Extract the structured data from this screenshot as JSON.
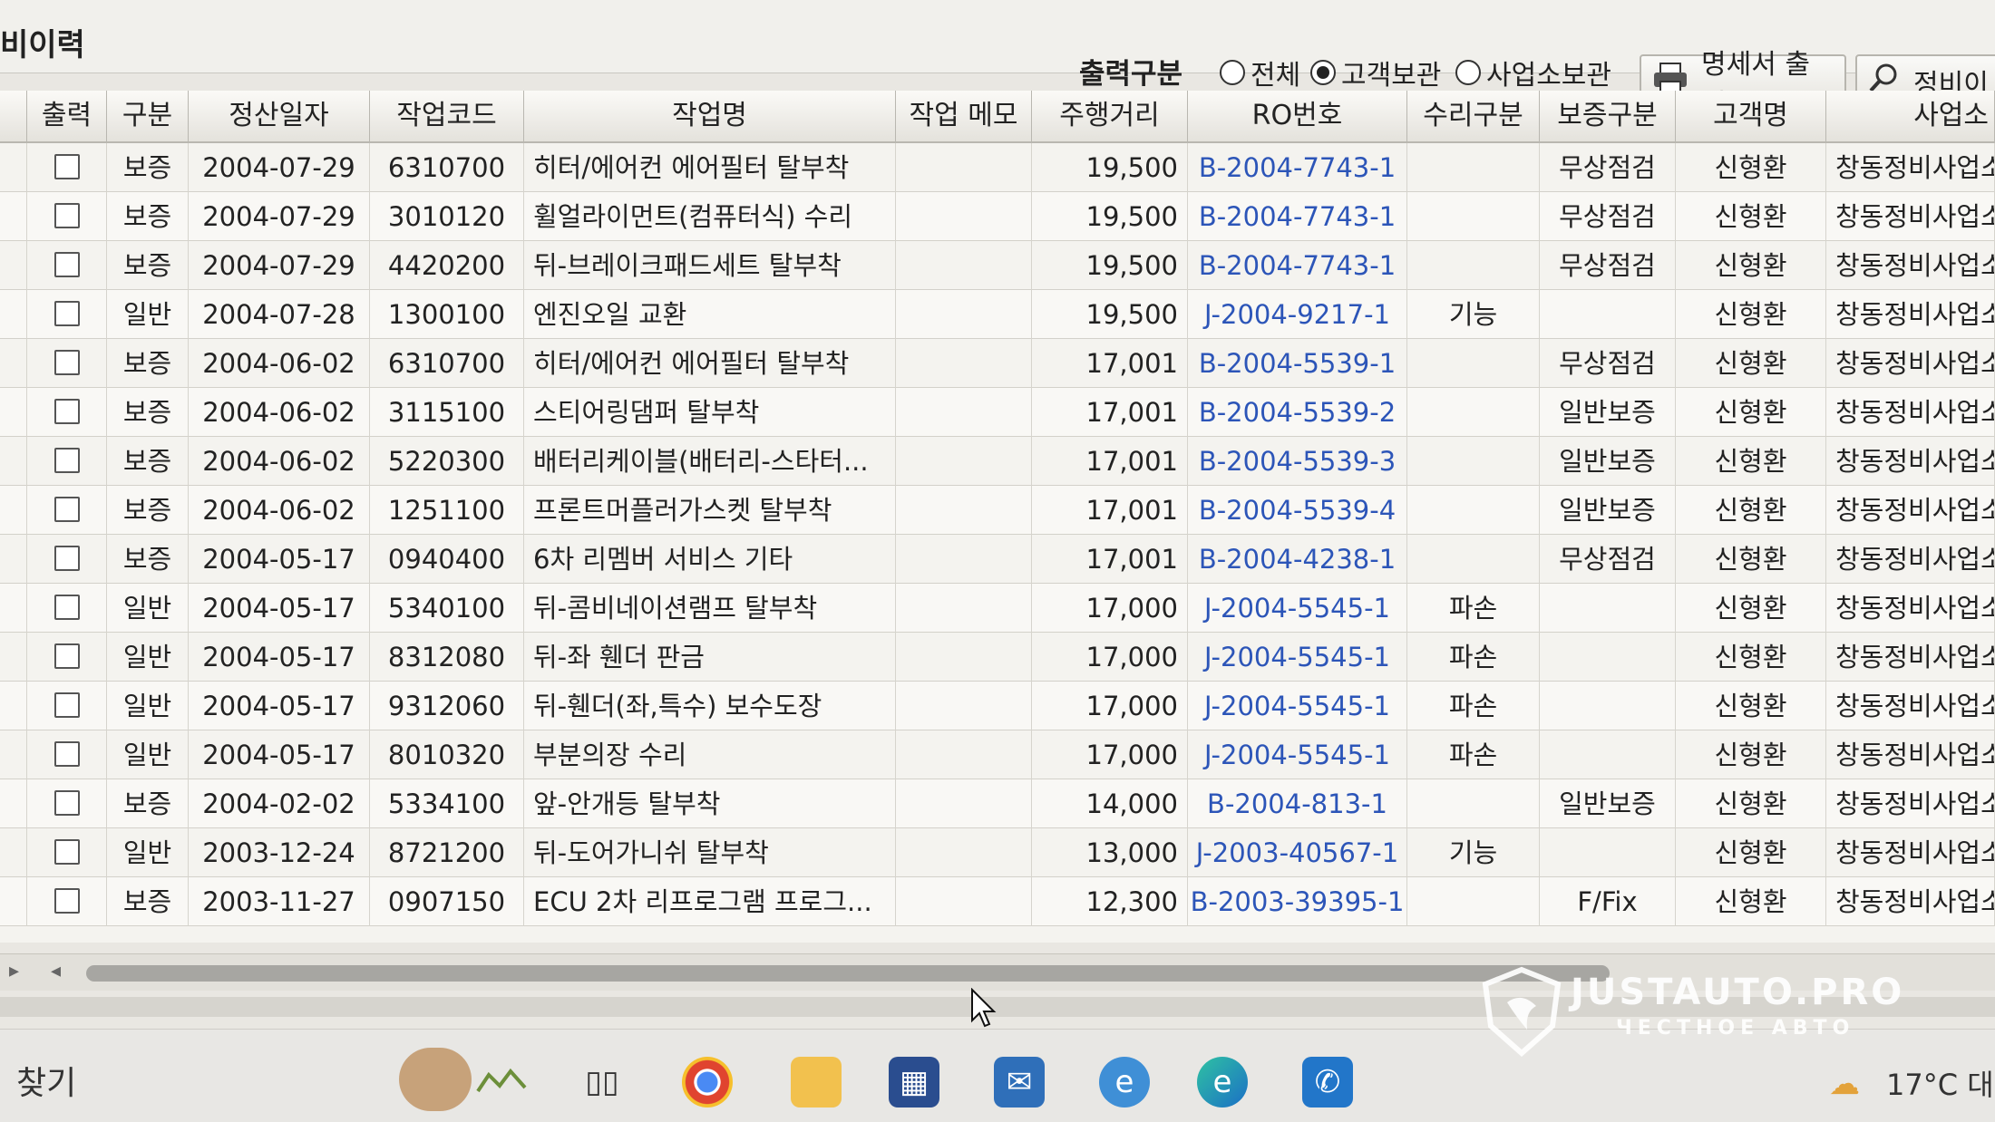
{
  "window": {
    "title": "비이력"
  },
  "toolbar": {
    "print_type_label": "출력구분",
    "radio_options": [
      {
        "label": "전체",
        "selected": false
      },
      {
        "label": "고객보관",
        "selected": true
      },
      {
        "label": "사업소보관",
        "selected": false
      }
    ],
    "print_button_label": "명세서 출력",
    "search_button_label": "정비이"
  },
  "table": {
    "columns": [
      "출력",
      "구분",
      "정산일자",
      "작업코드",
      "작업명",
      "작업 메모",
      "주행거리",
      "RO번호",
      "수리구분",
      "보증구분",
      "고객명",
      "사업소"
    ],
    "rows": [
      {
        "type": "보증",
        "date": "2004-07-29",
        "code": "6310700",
        "name": "히터/에어컨 에어필터 탈부착",
        "memo": "",
        "mileage": "19,500",
        "ro": "B-2004-7743-1",
        "repair": "",
        "warranty": "무상점검",
        "customer": "신형환",
        "office": "창동정비사업소"
      },
      {
        "type": "보증",
        "date": "2004-07-29",
        "code": "3010120",
        "name": "휠얼라이먼트(컴퓨터식) 수리",
        "memo": "",
        "mileage": "19,500",
        "ro": "B-2004-7743-1",
        "repair": "",
        "warranty": "무상점검",
        "customer": "신형환",
        "office": "창동정비사업소"
      },
      {
        "type": "보증",
        "date": "2004-07-29",
        "code": "4420200",
        "name": "뒤-브레이크패드세트 탈부착",
        "memo": "",
        "mileage": "19,500",
        "ro": "B-2004-7743-1",
        "repair": "",
        "warranty": "무상점검",
        "customer": "신형환",
        "office": "창동정비사업소"
      },
      {
        "type": "일반",
        "date": "2004-07-28",
        "code": "1300100",
        "name": "엔진오일 교환",
        "memo": "",
        "mileage": "19,500",
        "ro": "J-2004-9217-1",
        "repair": "기능",
        "warranty": "",
        "customer": "신형환",
        "office": "창동정비사업소"
      },
      {
        "type": "보증",
        "date": "2004-06-02",
        "code": "6310700",
        "name": "히터/에어컨 에어필터 탈부착",
        "memo": "",
        "mileage": "17,001",
        "ro": "B-2004-5539-1",
        "repair": "",
        "warranty": "무상점검",
        "customer": "신형환",
        "office": "창동정비사업소"
      },
      {
        "type": "보증",
        "date": "2004-06-02",
        "code": "3115100",
        "name": "스티어링댐퍼 탈부착",
        "memo": "",
        "mileage": "17,001",
        "ro": "B-2004-5539-2",
        "repair": "",
        "warranty": "일반보증",
        "customer": "신형환",
        "office": "창동정비사업소"
      },
      {
        "type": "보증",
        "date": "2004-06-02",
        "code": "5220300",
        "name": "배터리케이블(배터리-스타터...",
        "memo": "",
        "mileage": "17,001",
        "ro": "B-2004-5539-3",
        "repair": "",
        "warranty": "일반보증",
        "customer": "신형환",
        "office": "창동정비사업소"
      },
      {
        "type": "보증",
        "date": "2004-06-02",
        "code": "1251100",
        "name": "프론트머플러가스켓 탈부착",
        "memo": "",
        "mileage": "17,001",
        "ro": "B-2004-5539-4",
        "repair": "",
        "warranty": "일반보증",
        "customer": "신형환",
        "office": "창동정비사업소"
      },
      {
        "type": "보증",
        "date": "2004-05-17",
        "code": "0940400",
        "name": "6차 리멤버 서비스 기타",
        "memo": "",
        "mileage": "17,001",
        "ro": "B-2004-4238-1",
        "repair": "",
        "warranty": "무상점검",
        "customer": "신형환",
        "office": "창동정비사업소"
      },
      {
        "type": "일반",
        "date": "2004-05-17",
        "code": "5340100",
        "name": "뒤-콤비네이션램프 탈부착",
        "memo": "",
        "mileage": "17,000",
        "ro": "J-2004-5545-1",
        "repair": "파손",
        "warranty": "",
        "customer": "신형환",
        "office": "창동정비사업소"
      },
      {
        "type": "일반",
        "date": "2004-05-17",
        "code": "8312080",
        "name": "뒤-좌 휀더 판금",
        "memo": "",
        "mileage": "17,000",
        "ro": "J-2004-5545-1",
        "repair": "파손",
        "warranty": "",
        "customer": "신형환",
        "office": "창동정비사업소"
      },
      {
        "type": "일반",
        "date": "2004-05-17",
        "code": "9312060",
        "name": "뒤-휀더(좌,특수) 보수도장",
        "memo": "",
        "mileage": "17,000",
        "ro": "J-2004-5545-1",
        "repair": "파손",
        "warranty": "",
        "customer": "신형환",
        "office": "창동정비사업소"
      },
      {
        "type": "일반",
        "date": "2004-05-17",
        "code": "8010320",
        "name": "부분의장 수리",
        "memo": "",
        "mileage": "17,000",
        "ro": "J-2004-5545-1",
        "repair": "파손",
        "warranty": "",
        "customer": "신형환",
        "office": "창동정비사업소"
      },
      {
        "type": "보증",
        "date": "2004-02-02",
        "code": "5334100",
        "name": "앞-안개등 탈부착",
        "memo": "",
        "mileage": "14,000",
        "ro": "B-2004-813-1",
        "repair": "",
        "warranty": "일반보증",
        "customer": "신형환",
        "office": "창동정비사업소"
      },
      {
        "type": "일반",
        "date": "2003-12-24",
        "code": "8721200",
        "name": "뒤-도어가니쉬 탈부착",
        "memo": "",
        "mileage": "13,000",
        "ro": "J-2003-40567-1",
        "repair": "기능",
        "warranty": "",
        "customer": "신형환",
        "office": "창동정비사업소"
      },
      {
        "type": "보증",
        "date": "2003-11-27",
        "code": "0907150",
        "name": "ECU 2차 리프로그램 프로그...",
        "memo": "",
        "mileage": "12,300",
        "ro": "B-2003-39395-1",
        "repair": "",
        "warranty": "F/Fix",
        "customer": "신형환",
        "office": "창동정비사업소"
      }
    ]
  },
  "taskbar": {
    "search_label": "찾기",
    "temperature": "17°C",
    "extra": "대",
    "icons": [
      "avatar-widget",
      "stock-chart-icon",
      "task-view-icon",
      "chrome-icon",
      "file-explorer-icon",
      "microsoft-store-icon",
      "mail-icon",
      "internet-explorer-icon",
      "edge-icon",
      "phone-app-icon"
    ]
  },
  "watermark": {
    "brand": "JUSTAUTO.PRO",
    "subtitle": "ЧЕСТНОЕ АВТО"
  },
  "colors": {
    "ro_link": "#2c55b8",
    "header_bg": "#e4e2dc",
    "window_bg": "#e9e7e2"
  }
}
